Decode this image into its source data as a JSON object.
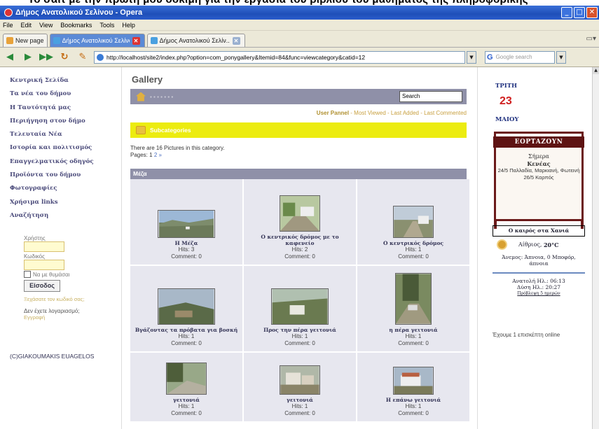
{
  "banner_text": "Το σάιτ με την πρώτη μου δοκιμή για την εργασία του βιβλίου του μαθήματος της πληροφορικής",
  "window": {
    "title": "Δήμος Ανατολικού Σελίνου - Opera"
  },
  "menu": [
    "File",
    "Edit",
    "View",
    "Bookmarks",
    "Tools",
    "Help"
  ],
  "tabs": [
    {
      "label": "New page"
    },
    {
      "label": "Δήμος Ανατολικού Σελίνου"
    },
    {
      "label": "Δήμος Ανατολικού Σελίν..."
    }
  ],
  "address": {
    "url": "http://localhost/site2/index.php?option=com_ponygallery&Itemid=84&func=viewcategory&catid=12"
  },
  "search_engine": {
    "placeholder": "Google search",
    "brand": "G"
  },
  "sidebar": {
    "items": [
      "Κεντρική Σελίδα",
      "Τα νέα του δήμου",
      "Η Ταυτότητά μας",
      "Περιήγηση στον δήμο",
      "Τελευταία Νέα",
      "Ιστορία και πολιτισμός",
      "Επαγγελματικός οδηγός",
      "Προϊόντα του δήμου",
      "Φωτογραφίες",
      "Χρήσιμα links",
      "Αναζήτηση"
    ]
  },
  "login": {
    "username_label": "Χρήστης",
    "password_label": "Κωδικός",
    "remember_label": "Να με θυμάσαι",
    "login_button": "Είσοδος",
    "forgot_link": "Ξεχάσατε τον κωδικό σας;",
    "no_account": "Δεν έχετε λογαριασμό;",
    "register_link": "Εγγραφή"
  },
  "copyright": "(C)GIAKOUMAKIS EUAGELOS",
  "gallery": {
    "heading": "Gallery",
    "search_value": "Search",
    "user_panel": "User Pannel",
    "links": "- Most Viewed - Last Added - Last Commented",
    "subcategories_label": "Subcategories",
    "count_text": "There are 16 Pictures in this category.",
    "pages_label": "Pages: 1",
    "pages_more": "2 »",
    "category_name": "Μέζα",
    "items": [
      {
        "caption": "Η Μέζα",
        "hits": "Hits: 3",
        "comments": "Comment: 0"
      },
      {
        "caption": "Ο κεντρικός δρόμος με το καφενείο",
        "hits": "Hits: 2",
        "comments": "Comment: 0"
      },
      {
        "caption": "Ο κεντρικός δρόμος",
        "hits": "Hits: 1",
        "comments": "Comment: 0"
      },
      {
        "caption": "Βγάζοντας τα πρόβατα για βοσκή",
        "hits": "Hits: 1",
        "comments": "Comment: 0"
      },
      {
        "caption": "Προς την πέρα γειτονιά",
        "hits": "Hits: 1",
        "comments": "Comment: 0"
      },
      {
        "caption": "η πέρα γειτονιά",
        "hits": "Hits: 1",
        "comments": "Comment: 0"
      },
      {
        "caption": "γειτονιά",
        "hits": "Hits: 1",
        "comments": "Comment: 0"
      },
      {
        "caption": "γειτονιά",
        "hits": "Hits: 1",
        "comments": "Comment: 0"
      },
      {
        "caption": "Η επάνω γειτονιά",
        "hits": "Hits: 1",
        "comments": "Comment: 0"
      }
    ]
  },
  "calendar": {
    "weekday": "ΤΡΙΤΗ",
    "day": "23",
    "month": "ΜΑΙΟΥ"
  },
  "festivals": {
    "title": "ΕΟΡΤΑΖΟΥΝ",
    "today_label": "Σήμερα",
    "today_name": "Κενέας",
    "line1": "24/5 Παλλαδία, Μαρκιανή, Φωτεινή",
    "line2": "26/5 Καρπός"
  },
  "weather": {
    "title": "Ο καιρός στα Χανιά",
    "condition": "Αίθριος,",
    "temp": "20°C",
    "wind": "Άνεμος: Άπνοια, 0 Μποφόρ, άπνοια",
    "sunrise": "Ανατολή Ηλ.: 06:13",
    "sunset": "Δύση Ηλ.: 20:27",
    "forecast_link": "Πρόβλεψη 5 ημερών"
  },
  "online_text": "Έχουμε 1 επισκέπτη online",
  "colors": {
    "accent_bar": "#8f90a8",
    "subcat_bar": "#ecec10",
    "title_bar": "#1f4fb8",
    "festival_frame": "#6b1a1a"
  }
}
